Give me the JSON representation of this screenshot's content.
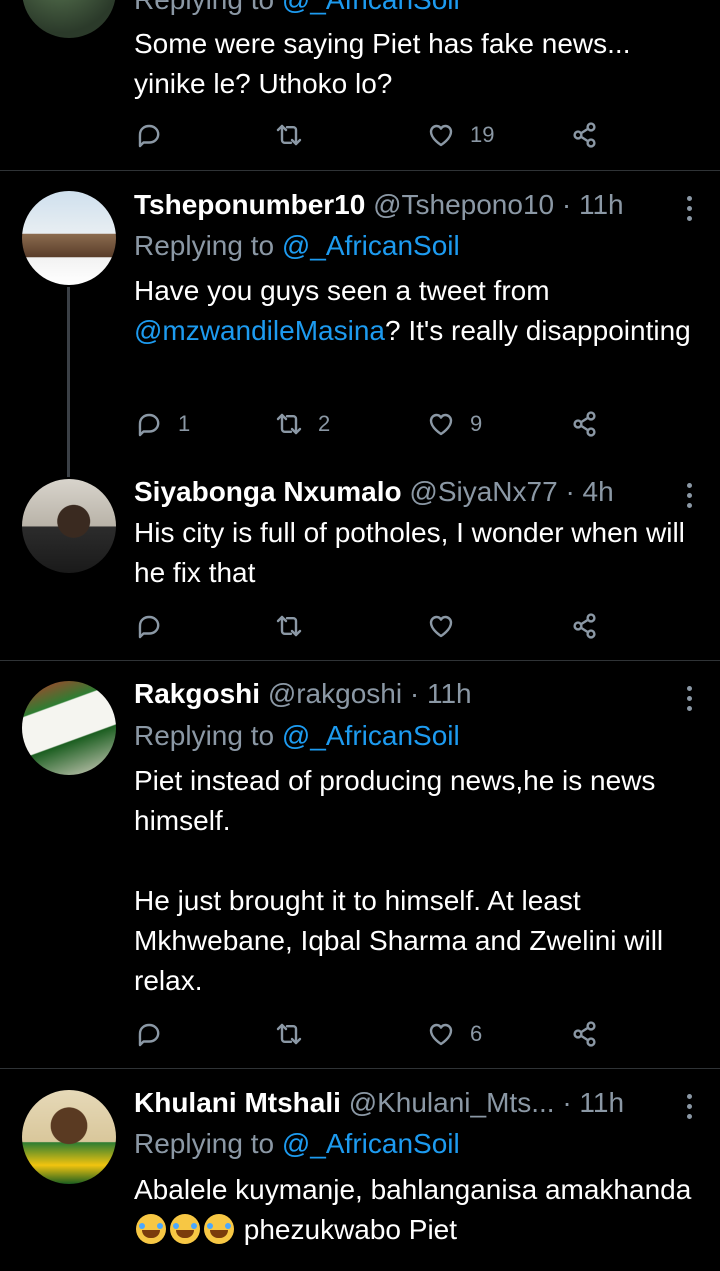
{
  "tweets": [
    {
      "name": "",
      "handle": "",
      "time": "",
      "replying_label": "Replying to",
      "replying_to": "@_AfricanSoil",
      "text": "Some were saying Piet has fake news... yinike le? Uthoko lo?",
      "replies": "",
      "retweets": "",
      "likes": "19"
    },
    {
      "name": "Tsheponumber10",
      "handle": "@Tshepono10",
      "time": "· 11h",
      "replying_label": "Replying to",
      "replying_to": "@_AfricanSoil",
      "text_before": "Have you guys seen a tweet from ",
      "mention": "@mzwandileMasina",
      "text_after": "? It's really disappointing",
      "replies": "1",
      "retweets": "2",
      "likes": "9"
    },
    {
      "name": "Siyabonga Nxumalo",
      "handle": "@SiyaNx77",
      "time": "· 4h",
      "text": "His city is full of potholes, I wonder when will he fix that",
      "replies": "",
      "retweets": "",
      "likes": ""
    },
    {
      "name": "Rakgoshi",
      "handle": "@rakgoshi",
      "time": "· 11h",
      "replying_label": "Replying to",
      "replying_to": "@_AfricanSoil",
      "text": "Piet instead of producing news,he is news himself.\n\nHe just brought it to himself. At least Mkhwebane, Iqbal Sharma and Zwelini will relax.",
      "replies": "",
      "retweets": "",
      "likes": "6"
    },
    {
      "name": "Khulani Mtshali",
      "handle": "@Khulani_Mts...",
      "time": "· 11h",
      "replying_label": "Replying to",
      "replying_to": "@_AfricanSoil",
      "text_before": "Abalele kuymanje, bahlanganisa amakhanda",
      "text_after": " phezukwabo Piet"
    }
  ],
  "icons": {
    "reply": "reply-icon",
    "retweet": "retweet-icon",
    "like": "heart-icon",
    "share": "share-icon",
    "more": "more-vertical-icon"
  },
  "colors": {
    "background": "#000000",
    "link": "#1d9bf0",
    "muted": "#8b98a5",
    "divider": "#2f3336"
  }
}
